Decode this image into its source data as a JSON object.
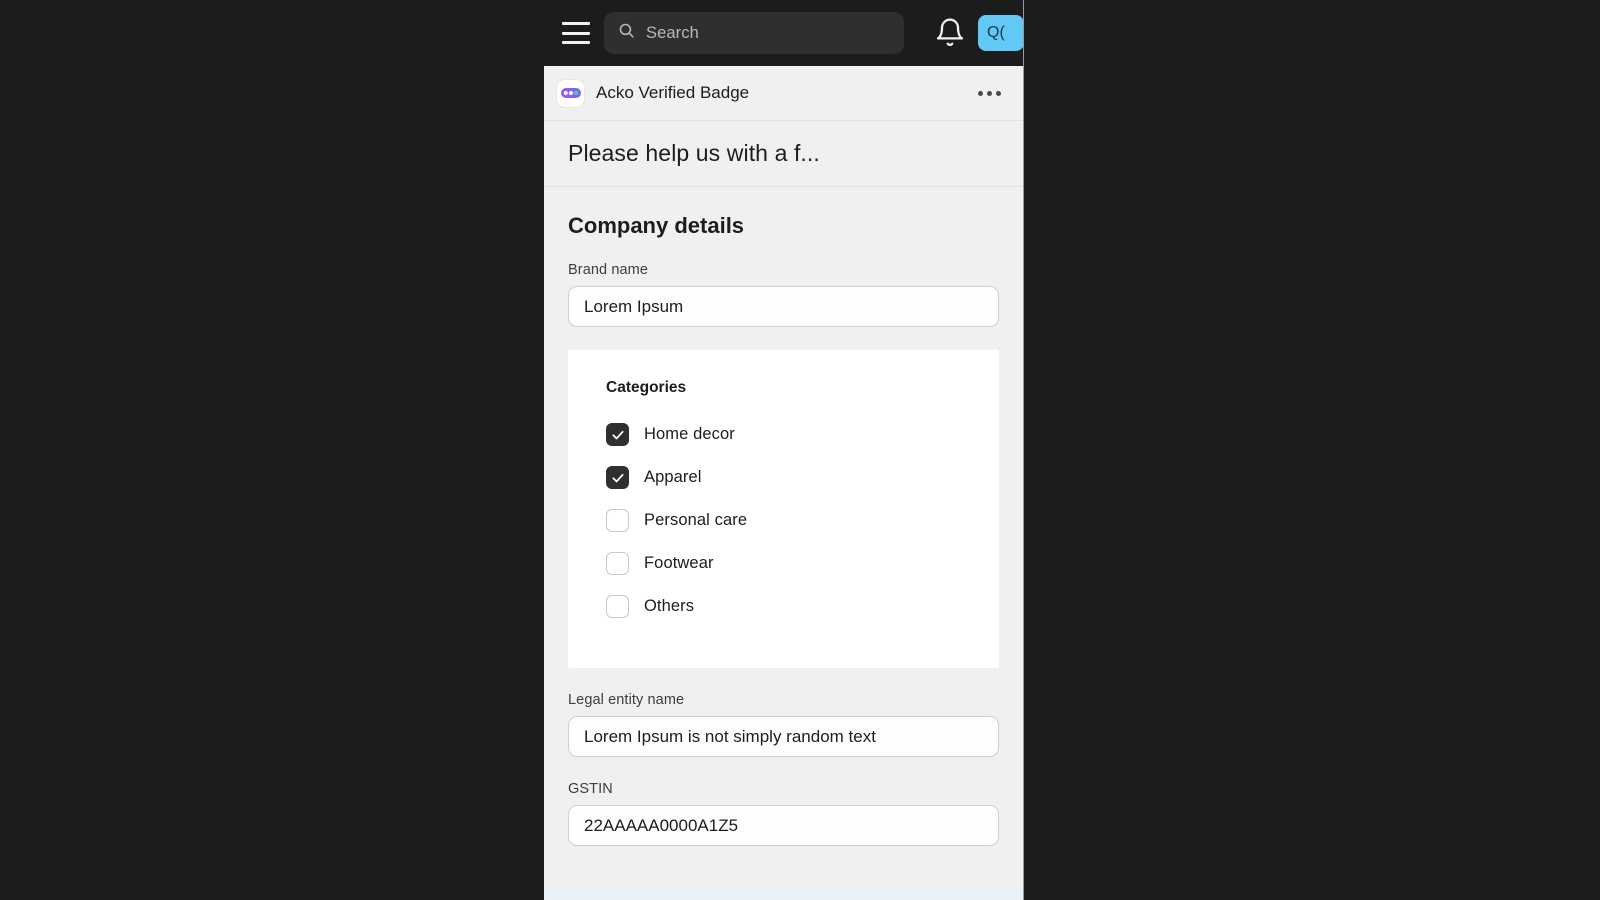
{
  "topbar": {
    "menu_icon": "hamburger-menu-icon",
    "search": {
      "placeholder": "Search",
      "value": "",
      "icon": "search-icon"
    },
    "notifications_icon": "bell-icon",
    "avatar_label": "Q(",
    "avatar_color": "#62c8f5",
    "background_color": "#1c1c1c"
  },
  "app_header": {
    "icon": "acko-app-icon",
    "title": "Acko Verified Badge",
    "overflow_icon": "more-options-kebab-icon"
  },
  "form": {
    "title": "Please help us with a f...",
    "section_title": "Company details",
    "fields": [
      {
        "label": "Brand name",
        "value": "Lorem Ipsum"
      },
      {
        "label": "Legal entity name",
        "value": "Lorem Ipsum is not simply random text"
      },
      {
        "label": "GSTIN",
        "value": "22AAAAA0000A1Z5"
      }
    ],
    "categories": {
      "title": "Categories",
      "options": [
        {
          "label": "Home decor",
          "checked": true
        },
        {
          "label": "Apparel",
          "checked": true
        },
        {
          "label": "Personal care",
          "checked": false
        },
        {
          "label": "Footwear",
          "checked": false
        },
        {
          "label": "Others",
          "checked": false
        }
      ]
    }
  },
  "colors": {
    "page_background": "#f0f0f0",
    "card_background": "#ffffff",
    "checkbox_checked": "#2f2f2f",
    "bottom_strip": "#e8f2f6"
  }
}
